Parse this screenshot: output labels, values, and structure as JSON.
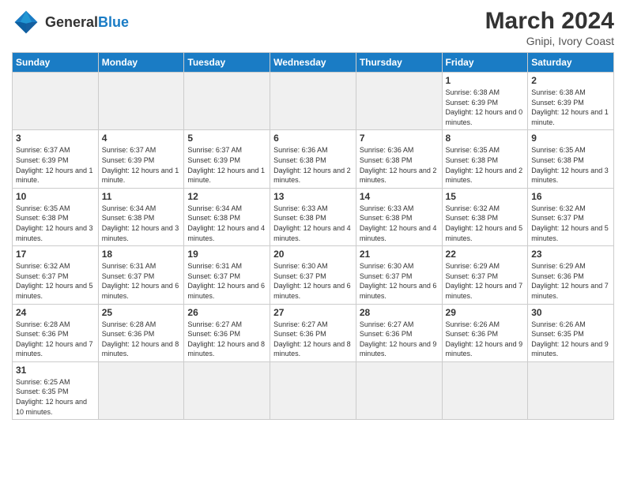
{
  "header": {
    "logo_general": "General",
    "logo_blue": "Blue",
    "month_year": "March 2024",
    "location": "Gnipi, Ivory Coast"
  },
  "days_of_week": [
    "Sunday",
    "Monday",
    "Tuesday",
    "Wednesday",
    "Thursday",
    "Friday",
    "Saturday"
  ],
  "weeks": [
    [
      {
        "day": "",
        "info": "",
        "empty": true
      },
      {
        "day": "",
        "info": "",
        "empty": true
      },
      {
        "day": "",
        "info": "",
        "empty": true
      },
      {
        "day": "",
        "info": "",
        "empty": true
      },
      {
        "day": "",
        "info": "",
        "empty": true
      },
      {
        "day": "1",
        "info": "Sunrise: 6:38 AM\nSunset: 6:39 PM\nDaylight: 12 hours\nand 0 minutes."
      },
      {
        "day": "2",
        "info": "Sunrise: 6:38 AM\nSunset: 6:39 PM\nDaylight: 12 hours\nand 1 minute."
      }
    ],
    [
      {
        "day": "3",
        "info": "Sunrise: 6:37 AM\nSunset: 6:39 PM\nDaylight: 12 hours\nand 1 minute."
      },
      {
        "day": "4",
        "info": "Sunrise: 6:37 AM\nSunset: 6:39 PM\nDaylight: 12 hours\nand 1 minute."
      },
      {
        "day": "5",
        "info": "Sunrise: 6:37 AM\nSunset: 6:39 PM\nDaylight: 12 hours\nand 1 minute."
      },
      {
        "day": "6",
        "info": "Sunrise: 6:36 AM\nSunset: 6:38 PM\nDaylight: 12 hours\nand 2 minutes."
      },
      {
        "day": "7",
        "info": "Sunrise: 6:36 AM\nSunset: 6:38 PM\nDaylight: 12 hours\nand 2 minutes."
      },
      {
        "day": "8",
        "info": "Sunrise: 6:35 AM\nSunset: 6:38 PM\nDaylight: 12 hours\nand 2 minutes."
      },
      {
        "day": "9",
        "info": "Sunrise: 6:35 AM\nSunset: 6:38 PM\nDaylight: 12 hours\nand 3 minutes."
      }
    ],
    [
      {
        "day": "10",
        "info": "Sunrise: 6:35 AM\nSunset: 6:38 PM\nDaylight: 12 hours\nand 3 minutes."
      },
      {
        "day": "11",
        "info": "Sunrise: 6:34 AM\nSunset: 6:38 PM\nDaylight: 12 hours\nand 3 minutes."
      },
      {
        "day": "12",
        "info": "Sunrise: 6:34 AM\nSunset: 6:38 PM\nDaylight: 12 hours\nand 4 minutes."
      },
      {
        "day": "13",
        "info": "Sunrise: 6:33 AM\nSunset: 6:38 PM\nDaylight: 12 hours\nand 4 minutes."
      },
      {
        "day": "14",
        "info": "Sunrise: 6:33 AM\nSunset: 6:38 PM\nDaylight: 12 hours\nand 4 minutes."
      },
      {
        "day": "15",
        "info": "Sunrise: 6:32 AM\nSunset: 6:38 PM\nDaylight: 12 hours\nand 5 minutes."
      },
      {
        "day": "16",
        "info": "Sunrise: 6:32 AM\nSunset: 6:37 PM\nDaylight: 12 hours\nand 5 minutes."
      }
    ],
    [
      {
        "day": "17",
        "info": "Sunrise: 6:32 AM\nSunset: 6:37 PM\nDaylight: 12 hours\nand 5 minutes."
      },
      {
        "day": "18",
        "info": "Sunrise: 6:31 AM\nSunset: 6:37 PM\nDaylight: 12 hours\nand 6 minutes."
      },
      {
        "day": "19",
        "info": "Sunrise: 6:31 AM\nSunset: 6:37 PM\nDaylight: 12 hours\nand 6 minutes."
      },
      {
        "day": "20",
        "info": "Sunrise: 6:30 AM\nSunset: 6:37 PM\nDaylight: 12 hours\nand 6 minutes."
      },
      {
        "day": "21",
        "info": "Sunrise: 6:30 AM\nSunset: 6:37 PM\nDaylight: 12 hours\nand 6 minutes."
      },
      {
        "day": "22",
        "info": "Sunrise: 6:29 AM\nSunset: 6:37 PM\nDaylight: 12 hours\nand 7 minutes."
      },
      {
        "day": "23",
        "info": "Sunrise: 6:29 AM\nSunset: 6:36 PM\nDaylight: 12 hours\nand 7 minutes."
      }
    ],
    [
      {
        "day": "24",
        "info": "Sunrise: 6:28 AM\nSunset: 6:36 PM\nDaylight: 12 hours\nand 7 minutes."
      },
      {
        "day": "25",
        "info": "Sunrise: 6:28 AM\nSunset: 6:36 PM\nDaylight: 12 hours\nand 8 minutes."
      },
      {
        "day": "26",
        "info": "Sunrise: 6:27 AM\nSunset: 6:36 PM\nDaylight: 12 hours\nand 8 minutes."
      },
      {
        "day": "27",
        "info": "Sunrise: 6:27 AM\nSunset: 6:36 PM\nDaylight: 12 hours\nand 8 minutes."
      },
      {
        "day": "28",
        "info": "Sunrise: 6:27 AM\nSunset: 6:36 PM\nDaylight: 12 hours\nand 9 minutes."
      },
      {
        "day": "29",
        "info": "Sunrise: 6:26 AM\nSunset: 6:36 PM\nDaylight: 12 hours\nand 9 minutes."
      },
      {
        "day": "30",
        "info": "Sunrise: 6:26 AM\nSunset: 6:35 PM\nDaylight: 12 hours\nand 9 minutes."
      }
    ],
    [
      {
        "day": "31",
        "info": "Sunrise: 6:25 AM\nSunset: 6:35 PM\nDaylight: 12 hours\nand 10 minutes."
      },
      {
        "day": "",
        "info": "",
        "empty": true
      },
      {
        "day": "",
        "info": "",
        "empty": true
      },
      {
        "day": "",
        "info": "",
        "empty": true
      },
      {
        "day": "",
        "info": "",
        "empty": true
      },
      {
        "day": "",
        "info": "",
        "empty": true
      },
      {
        "day": "",
        "info": "",
        "empty": true
      }
    ]
  ]
}
